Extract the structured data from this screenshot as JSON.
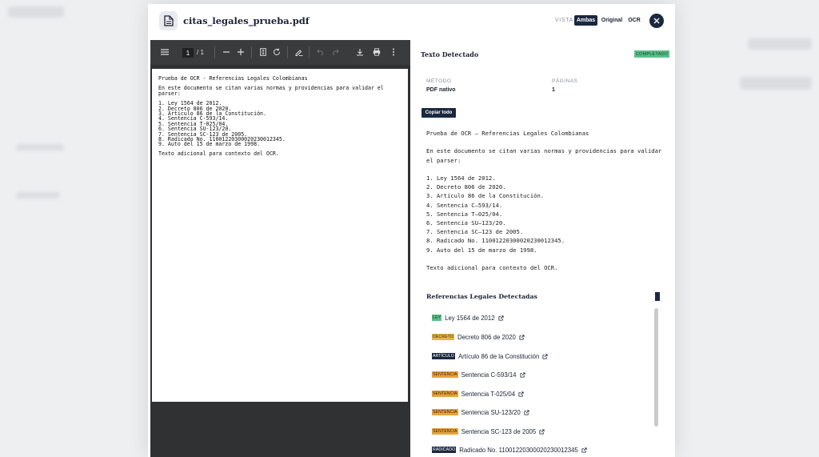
{
  "modal": {
    "file_name": "citas_legales_prueba.pdf",
    "view_label": "VISTA",
    "view_options": [
      "Ambas",
      "Original",
      "OCR"
    ],
    "view_selected": "Ambas"
  },
  "viewer": {
    "page_current": "1",
    "page_total": "/ 1",
    "pdf_lines": {
      "title": "Prueba de OCR - Referencias Legales Colombianas",
      "intro": "En este documento se citan varias normas y providencias para validar el parser:",
      "items": [
        "1. Ley 1564 de 2012.",
        "2. Decreto 806 de 2020.",
        "3. Artículo 86 de la Constitución.",
        "4. Sentencia C-593/14.",
        "5. Sentencia T-025/04.",
        "6. Sentencia SU-123/20.",
        "7. Sentencia SC-123 de 2005.",
        "8. Radicado No. 11001220300020230012345.",
        "9. Auto del 15 de marzo de 1998."
      ],
      "footer": "Texto adicional para contexto del OCR."
    }
  },
  "panel": {
    "title": "Texto Detectado",
    "status": "COMPLETADO",
    "colors": {
      "status_bg": "#5bbf8a",
      "accent": "#1b2840"
    },
    "method_label": "MÉTODO",
    "method_value": "PDF nativo",
    "pages_label": "PÁGINAS",
    "pages_value": "1",
    "copy_label": "Copiar todo",
    "ocr_text": {
      "title": "Prueba de OCR – Referencias Legales Colombianas",
      "intro_1": "En este documento se citan varias normas y providencias para validar",
      "intro_2": "el parser:",
      "items": [
        "1. Ley 1564 de 2012.",
        "2. Decreto 806 de 2020.",
        "3. Artículo 86 de la Constitución.",
        "4. Sentencia C–593/14.",
        "5. Sentencia T–025/04.",
        "6. Sentencia SU–123/20.",
        "7. Sentencia SC–123 de 2005.",
        "8. Radicado No. 11001220300020230012345.",
        "9. Auto del 15 de marzo de 1998."
      ],
      "footer": "Texto adicional para contexto del OCR."
    },
    "refs_title": "Referencias Legales Detectadas",
    "refs": [
      {
        "tag": "LEY",
        "text": "Ley 1564 de 2012",
        "tag_bg": "#5bbf8a",
        "tag_fg": "#17422b"
      },
      {
        "tag": "DECRETO",
        "text": "Decreto 806 de 2020",
        "tag_bg": "#e6b54a",
        "tag_fg": "#3a2a05"
      },
      {
        "tag": "ARTÍCULO",
        "text": "Artículo 86 de la Constitución",
        "tag_bg": "#1b2840",
        "tag_fg": "#ffffff"
      },
      {
        "tag": "SENTENCIA",
        "text": "Sentencia C-593/14",
        "tag_bg": "#e8a23c",
        "tag_fg": "#3a2205"
      },
      {
        "tag": "SENTENCIA",
        "text": "Sentencia T-025/04",
        "tag_bg": "#e8a23c",
        "tag_fg": "#3a2205"
      },
      {
        "tag": "SENTENCIA",
        "text": "Sentencia SU-123/20",
        "tag_bg": "#e8a23c",
        "tag_fg": "#3a2205"
      },
      {
        "tag": "SENTENCIA",
        "text": "Sentencia SC-123 de 2005",
        "tag_bg": "#e8a23c",
        "tag_fg": "#3a2205"
      },
      {
        "tag": "RADICADO",
        "text": "Radicado No. 11001220300020230012345",
        "tag_bg": "#1b2840",
        "tag_fg": "#ffffff"
      }
    ]
  }
}
